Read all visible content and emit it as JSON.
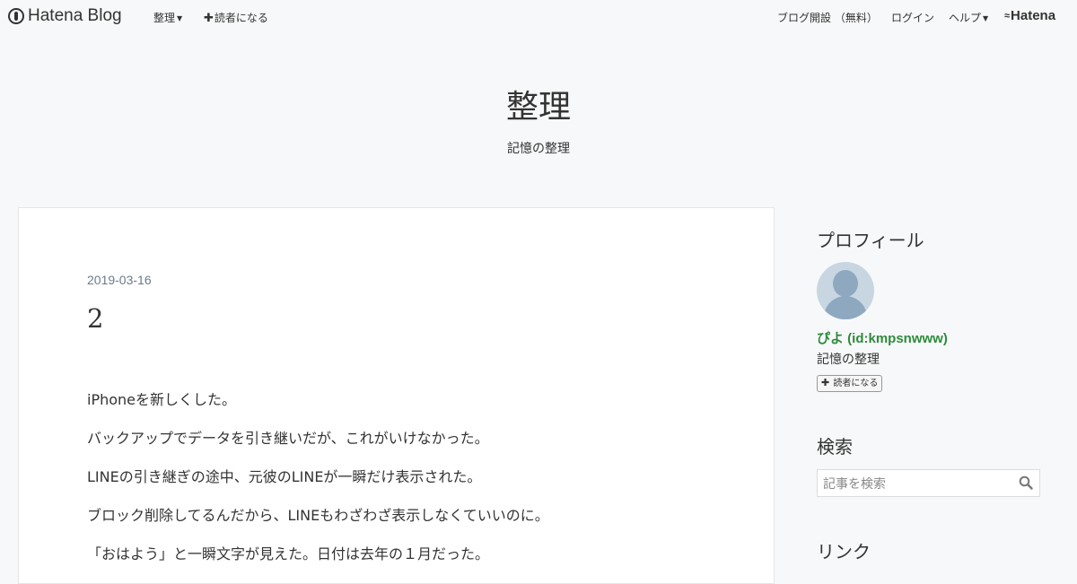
{
  "topbar": {
    "logo_text": "Hatena Blog",
    "menu_label": "整理",
    "subscribe_label": "読者になる",
    "signup_label": "ブログ開設 （無料）",
    "login_label": "ログイン",
    "help_label": "ヘルプ",
    "hatena_label": "Hatena"
  },
  "blog": {
    "title": "整理",
    "description": "記憶の整理"
  },
  "entry": {
    "date": "2019-03-16",
    "title": "2",
    "paragraphs": [
      "iPhoneを新しくした。",
      "バックアップでデータを引き継いだが、これがいけなかった。",
      "LINEの引き継ぎの途中、元彼のLINEが一瞬だけ表示された。",
      "ブロック削除してるんだから、LINEもわざわざ表示しなくていいのに。",
      "「おはよう」と一瞬文字が見えた。日付は去年の１月だった。"
    ]
  },
  "sidebar": {
    "profile_title": "プロフィール",
    "profile_name": "ぴよ (id:kmpsnwww)",
    "profile_desc": "記憶の整理",
    "subscribe_label": "読者になる",
    "search_title": "検索",
    "search_placeholder": "記事を検索",
    "links_title": "リンク"
  },
  "colors": {
    "background": "#f7f8f9",
    "card": "#ffffff",
    "profile_name": "#2e8b3c",
    "date": "#6b7b8a"
  }
}
